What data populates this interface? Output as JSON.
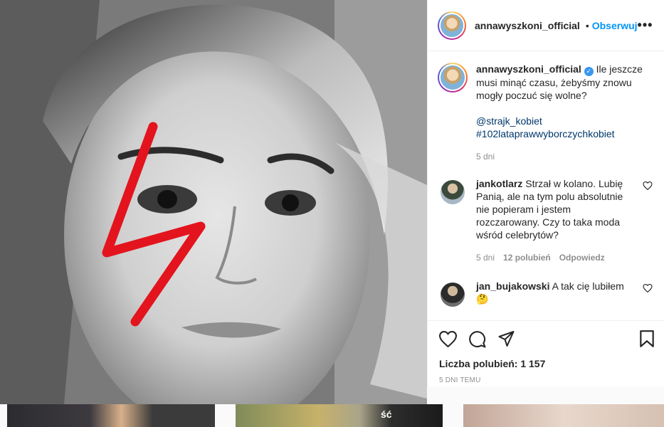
{
  "post": {
    "username": "annawyszkoni_official",
    "follow_label": "Obserwuj",
    "separator": "•",
    "more_label": "•••",
    "caption": "Ile jeszcze musi minąć czasu, żebyśmy znowu mogły poczuć się wolne?",
    "mention": "@strajk_kobiet",
    "hashtag": "#102lataprawwyborczychkobiet",
    "caption_time": "5 dni",
    "likes_label": "Liczba polubień: 1 157",
    "timestamp": "5 dni temu"
  },
  "comments": [
    {
      "username": "jankotlarz",
      "text": "Strzał w kolano. Lubię Panią, ale na tym polu absolutnie nie popieram i jestem rozczarowany. Czy to taka moda wśród celebrytów?",
      "time": "5 dni",
      "likes": "12 polubień",
      "reply": "Odpowiedz"
    },
    {
      "username": "jan_bujakowski",
      "text": "A tak cię lubiłem",
      "emoji": "🤔"
    }
  ],
  "thumbnail_label": "ść",
  "colors": {
    "accent": "#0095f6",
    "text": "#262626",
    "muted": "#8e8e8e",
    "lightning": "#e3141e"
  },
  "icons": [
    "heart-icon",
    "comment-icon",
    "share-icon",
    "bookmark-icon",
    "more-icon",
    "verified-icon"
  ]
}
